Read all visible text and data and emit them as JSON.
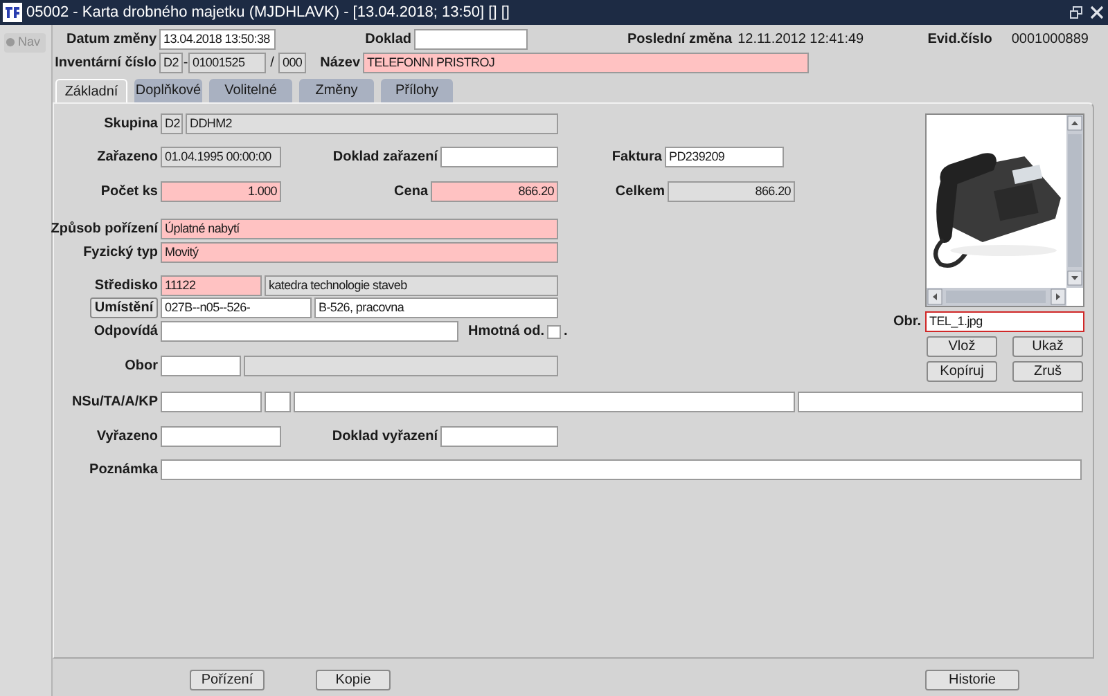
{
  "window": {
    "title": "05002 - Karta drobného majetku (MJDHLAVK) - [13.04.2018; 13:50] [] []"
  },
  "nav": {
    "label": "Nav"
  },
  "header": {
    "datum_zmeny": {
      "label": "Datum změny",
      "value": "13.04.2018 13:50:38",
      "kind": "editable"
    },
    "doklad": {
      "label": "Doklad",
      "kind": "editable"
    },
    "posledni_zmena": {
      "label": "Poslední změna",
      "value": "12.11.2012 12:41:49"
    },
    "evid_cislo": {
      "label": "Evid.číslo",
      "value": "0001000889"
    },
    "inventarni_cislo": {
      "label": "Inventární číslo",
      "prefix": {
        "value": "D2",
        "kind": "readonly"
      },
      "separator_1": "-",
      "number": {
        "value": "01001525",
        "kind": "readonly"
      },
      "separator_2": "/",
      "suffix": {
        "value": "000",
        "kind": "readonly"
      }
    },
    "nazev": {
      "label": "Název",
      "value": "TELEFONNI PRISTROJ",
      "kind": "required"
    }
  },
  "tabs": [
    {
      "label": "Základní",
      "selected": true
    },
    {
      "label": "Doplňkové",
      "selected": false
    },
    {
      "label": "Volitelné",
      "selected": false
    },
    {
      "label": "Změny",
      "selected": false
    },
    {
      "label": "Přílohy",
      "selected": false
    }
  ],
  "form": {
    "skupina": {
      "label": "Skupina",
      "code": {
        "value": "D2",
        "kind": "readonly"
      },
      "name": {
        "value": "DDHM2",
        "kind": "readonly"
      }
    },
    "zarazeno": {
      "label": "Zařazeno",
      "value": "01.04.1995 00:00:00",
      "kind": "readonly"
    },
    "doklad_zarazeni": {
      "label": "Doklad zařazení",
      "kind": "editable"
    },
    "faktura": {
      "label": "Faktura",
      "value": "PD239209",
      "kind": "editable"
    },
    "pocet_ks": {
      "label": "Počet ks",
      "value": "1.000",
      "kind": "required"
    },
    "cena": {
      "label": "Cena",
      "value": "866.20",
      "kind": "required"
    },
    "celkem": {
      "label": "Celkem",
      "value": "866.20",
      "kind": "readonly"
    },
    "zpusob_porizeni": {
      "label": "Způsob pořízení",
      "value": "Úplatné nabytí",
      "kind": "required"
    },
    "fyzicky_typ": {
      "label": "Fyzický typ",
      "value": "Movitý",
      "kind": "required"
    },
    "stredisko": {
      "label": "Středisko",
      "code": {
        "value": "11122",
        "kind": "required"
      },
      "name": {
        "value": "katedra technologie staveb",
        "kind": "readonly"
      }
    },
    "umisteni": {
      "button": "Umístění",
      "code": {
        "value": "027B--n05--526-",
        "kind": "editable"
      },
      "name": {
        "value": "B-526, pracovna",
        "kind": "editable"
      }
    },
    "odpovida": {
      "label": "Odpovídá",
      "kind": "editable"
    },
    "hmotna_od": {
      "label": "Hmotná od.",
      "checked": false,
      "suffix": "."
    },
    "obor": {
      "label": "Obor",
      "code": {
        "kind": "editable"
      },
      "name": {
        "kind": "readonly"
      }
    },
    "nsu_ta_a_kp": {
      "label": "NSu/TA/A/KP",
      "parts": [
        {
          "kind": "editable"
        },
        {
          "kind": "editable"
        },
        {
          "kind": "editable"
        },
        {
          "kind": "editable"
        }
      ]
    },
    "vyrazeno": {
      "label": "Vyřazeno",
      "kind": "editable"
    },
    "doklad_vyrazeni": {
      "label": "Doklad vyřazení",
      "kind": "editable"
    },
    "poznamka": {
      "label": "Poznámka",
      "kind": "editable"
    }
  },
  "image_panel": {
    "obr": {
      "label": "Obr.",
      "value": "TEL_1.jpg",
      "kind": "editable",
      "focused": true
    },
    "buttons": [
      "Vlož",
      "Ukaž",
      "Kopíruj",
      "Zruš"
    ]
  },
  "footer_buttons": [
    "Pořízení",
    "Kopie",
    "Historie"
  ]
}
